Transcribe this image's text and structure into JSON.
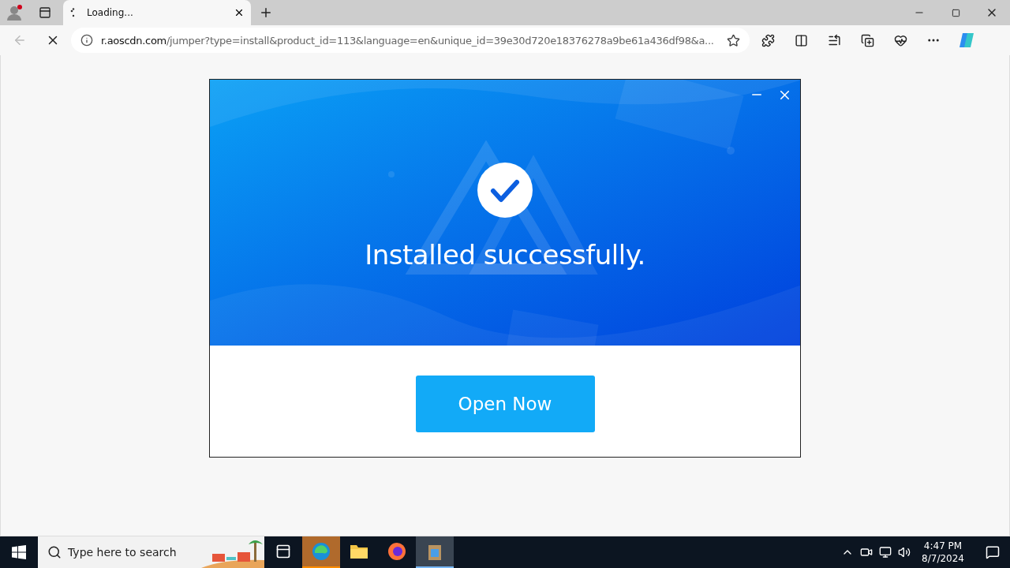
{
  "browser": {
    "tab": {
      "title": "Loading...",
      "selected": true
    },
    "url_host": "r.aoscdn.com",
    "url_rest": "/jumper?type=install&product_id=113&language=en&unique_id=39e30d720e18376278a9be61a436df98&a..."
  },
  "dialog": {
    "message": "Installed successfully.",
    "button": "Open Now"
  },
  "taskbar": {
    "search_placeholder": "Type here to search",
    "apps": [
      {
        "kind": "taskview",
        "selected": false,
        "flashing": false
      },
      {
        "kind": "edge",
        "selected": false,
        "flashing": true
      },
      {
        "kind": "explorer",
        "selected": false,
        "flashing": false
      },
      {
        "kind": "firefox",
        "selected": false,
        "flashing": false
      },
      {
        "kind": "installer",
        "selected": true,
        "flashing": false
      }
    ],
    "time": "4:47 PM",
    "date": "8/7/2024"
  }
}
